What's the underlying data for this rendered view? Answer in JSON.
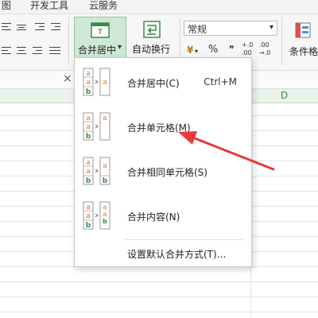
{
  "menu_tabs": [
    "图",
    "开发工具",
    "云服务"
  ],
  "ribbon": {
    "merge_center_label": "合并居中",
    "merge_center_arrow": "▾",
    "auto_wrap_label": "自动换行",
    "number_format_value": "常规",
    "number_format_arrow": "▾",
    "currency_symbol": "¥",
    "percent_symbol": "%",
    "comma_symbol": "❞",
    "inc_decimal_top": "+.0",
    "inc_decimal_bottom": ".00",
    "dec_decimal_top": ".00",
    "dec_decimal_bottom": "→.0",
    "conditional_format_label": "条件格"
  },
  "sheet": {
    "close_symbol": "×",
    "column_d": "D"
  },
  "dropdown": {
    "items": [
      {
        "label": "合并居中(C)",
        "shortcut": "Ctrl+M"
      },
      {
        "label": "合并单元格(M)",
        "shortcut": ""
      },
      {
        "label": "合并相同单元格(S)",
        "shortcut": ""
      },
      {
        "label": "合并内容(N)",
        "shortcut": ""
      }
    ],
    "footer_item": "设置默认合并方式(T)..."
  },
  "icon_letters": {
    "a": "a",
    "b": "b"
  },
  "colors": {
    "accent_green": "#3a8a4a",
    "selected_bg": "#cfe8d6",
    "annotation_red": "#e83a3a",
    "letter_orange": "#e0781e"
  }
}
